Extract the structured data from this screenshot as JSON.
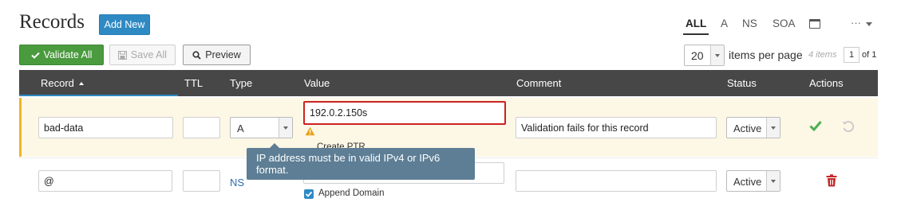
{
  "page": {
    "title": "Records",
    "add_new_label": "Add New"
  },
  "filters": {
    "all": "ALL",
    "a": "A",
    "ns": "NS",
    "soa": "SOA",
    "more": "···",
    "calendar_icon": "calendar-icon"
  },
  "toolbar": {
    "validate_all_label": "Validate All",
    "save_all_label": "Save All",
    "preview_label": "Preview",
    "per_page_value": "20",
    "per_page_label": "items per page",
    "items_count": "4 items",
    "page_current": "1",
    "page_of": "of 1"
  },
  "table": {
    "headers": {
      "record": "Record",
      "ttl": "TTL",
      "type": "Type",
      "value": "Value",
      "comment": "Comment",
      "status": "Status",
      "actions": "Actions"
    },
    "rows": [
      {
        "record": "bad-data",
        "ttl": "",
        "type": "A",
        "value": "192.0.2.150s",
        "create_ptr_label": "Create PTR",
        "comment": "Validation fails for this record",
        "status": "Active",
        "error_tooltip": "IP address must be in valid IPv4 or IPv6 format."
      },
      {
        "record": "@",
        "ttl": "",
        "type": "NS",
        "value": "",
        "append_domain_label": "Append Domain",
        "comment": "",
        "status": "Active"
      }
    ]
  },
  "colors": {
    "accent_blue": "#2f8ac4",
    "validate_green": "#4a9a3e",
    "header_bg": "#474747",
    "error_red": "#cc2222",
    "warning_row_bg": "#fdf7e6",
    "warning_border": "#f0b429",
    "tooltip_bg": "#5d7e95"
  }
}
